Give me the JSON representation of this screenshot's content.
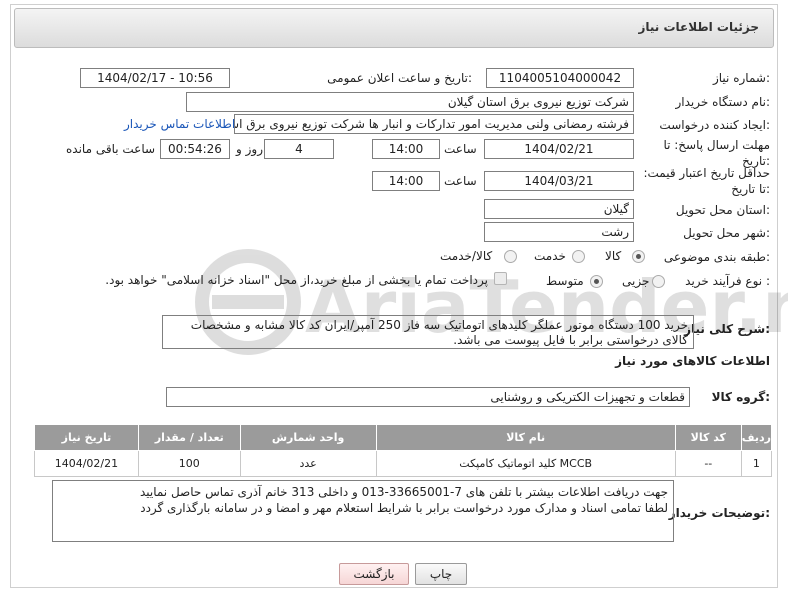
{
  "header": {
    "title": "جزئیات اطلاعات نیاز"
  },
  "form": {
    "need_number_label": "شماره نیاز:",
    "need_number": "1104005104000042",
    "announce_label": "تاریخ و ساعت اعلان عمومی:",
    "announce_value": "1404/02/17 - 10:56",
    "buyer_org_label": "نام دستگاه خریدار:",
    "buyer_org": "شرکت توزیع نیروی برق استان گیلان",
    "creator_label": "ایجاد کننده درخواست:",
    "creator": "فرشته رمضانی ولنی مدیریت امور تدارکات و انبار ها شرکت توزیع نیروی برق استان",
    "contact_link": "اطلاعات تماس خریدار",
    "reply_deadline_label": "مهلت ارسال پاسخ: تا تاریخ:",
    "reply_date": "1404/02/21",
    "time_label": "ساعت",
    "reply_time": "14:00",
    "days_value": "4",
    "days_label": "روز و",
    "remaining_time": "00:54:26",
    "remaining_label": "ساعت باقی مانده",
    "price_validity_label": "حداقل تاریخ اعتبار قیمت: تا تاریخ:",
    "price_date": "1404/03/21",
    "price_time": "14:00",
    "province_label": "استان محل تحویل:",
    "province": "گیلان",
    "city_label": "شهر محل تحویل:",
    "city": "رشت",
    "category_label": "طبقه بندی موضوعی:",
    "category_options": [
      "کالا",
      "خدمت",
      "کالا/خدمت"
    ],
    "process_label": "نوع فرآیند خرید :",
    "process_options": [
      "جزیی",
      "متوسط"
    ],
    "payment_note": "پرداخت تمام یا بخشی از مبلغ خرید،از محل \"اسناد خزانه اسلامی\" خواهد بود."
  },
  "description": {
    "label": "شرح کلی نیاز:",
    "text": "خرید 100 دستگاه موتور عملگر کلیدهای اتوماتیک سه فاز 250 آمپر/ایران کد کالا مشابه و مشخصات کالای درخواستی برابر با فایل پیوست می باشد."
  },
  "goods": {
    "section_title": "اطلاعات کالاهای مورد نیاز",
    "group_label": "گروه کالا:",
    "group_value": "قطعات و تجهیزات الکتریکی و روشنایی",
    "columns": [
      "ردیف",
      "کد کالا",
      "نام کالا",
      "واحد شمارش",
      "تعداد / مقدار",
      "تاریخ نیاز"
    ],
    "rows": [
      {
        "row": "1",
        "code": "--",
        "name": "کلید اتوماتیک کامپکت MCCB",
        "unit": "عدد",
        "qty": "100",
        "date": "1404/02/21"
      }
    ]
  },
  "buyer_notes": {
    "label": "توضیحات خریدار:",
    "line1": "جهت دریافت اطلاعات بیشتر با تلفن های 7-33665001-013 و داخلی 313 خانم آذری تماس حاصل نمایید",
    "line2": "لطفا تمامی اسناد و مدارک مورد درخواست برابر با شرایط استعلام مهر و امضا و در سامانه بارگذاری گردد"
  },
  "buttons": {
    "print": "چاپ",
    "back": "بازگشت"
  },
  "watermark": {
    "text": "AriaTender.neT"
  }
}
